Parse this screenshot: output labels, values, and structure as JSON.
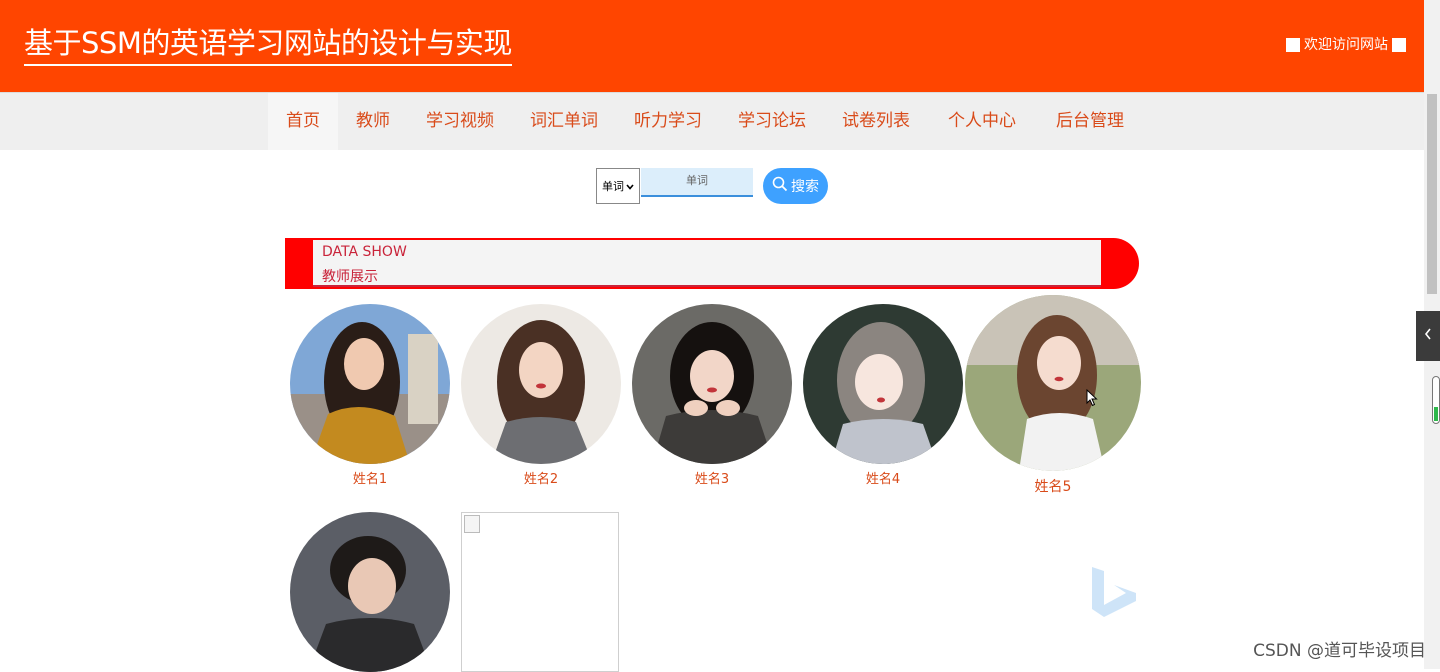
{
  "header": {
    "title": "基于SSM的英语学习网站的设计与实现",
    "welcome": "欢迎访问网站"
  },
  "nav": {
    "items": [
      "首页",
      "教师",
      "学习视频",
      "词汇单词",
      "听力学习",
      "学习论坛",
      "试卷列表",
      "个人中心",
      "后台管理"
    ],
    "active_index": 0
  },
  "search": {
    "select_value": "单词",
    "input_placeholder": "单词",
    "button_label": "搜索"
  },
  "section": {
    "title_en": "DATA SHOW",
    "title_cn": "教师展示"
  },
  "teachers": [
    {
      "name": "姓名1"
    },
    {
      "name": "姓名2"
    },
    {
      "name": "姓名3"
    },
    {
      "name": "姓名4"
    },
    {
      "name": "姓名5"
    }
  ],
  "watermark": "CSDN @道可毕设项目",
  "colors": {
    "header_bg": "#ff4500",
    "nav_text": "#d94b1a",
    "section_accent": "#ff0000",
    "search_button": "#3ea1ff"
  }
}
